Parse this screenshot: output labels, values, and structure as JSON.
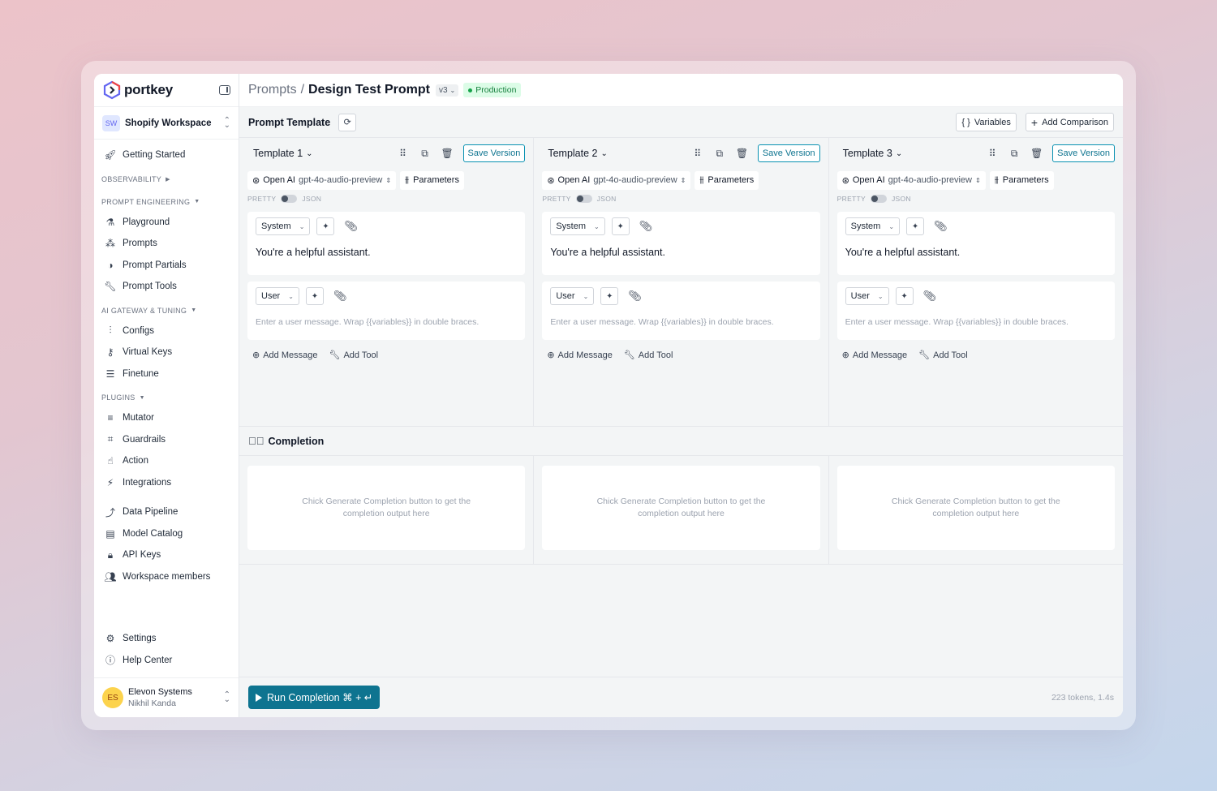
{
  "app": {
    "logo_text": "portkey",
    "accent": "#0e7490",
    "brand_colors": [
      "#6366f1",
      "#ef4444",
      "#1f2937"
    ]
  },
  "workspace": {
    "badge": "SW",
    "name": "Shopify Workspace"
  },
  "sidebar": {
    "getting_started": "Getting Started",
    "sections": {
      "observability": "OBSERVABILITY",
      "prompt_engineering": "PROMPT ENGINEERING",
      "ai_gateway": "AI GATEWAY & TUNING",
      "plugins": "PLUGINS"
    },
    "prompt_items": [
      {
        "label": "Playground",
        "icon": "flask-icon"
      },
      {
        "label": "Prompts",
        "icon": "prompts-icon"
      },
      {
        "label": "Prompt Partials",
        "icon": "partials-icon"
      },
      {
        "label": "Prompt Tools",
        "icon": "wrench-icon"
      }
    ],
    "gateway_items": [
      {
        "label": "Configs",
        "icon": "sliders-icon"
      },
      {
        "label": "Virtual Keys",
        "icon": "key-icon"
      },
      {
        "label": "Finetune",
        "icon": "finetune-icon"
      }
    ],
    "plugin_items": [
      {
        "label": "Mutator",
        "icon": "mutator-icon"
      },
      {
        "label": "Guardrails",
        "icon": "guardrails-icon"
      },
      {
        "label": "Action",
        "icon": "action-icon"
      },
      {
        "label": "Integrations",
        "icon": "plug-icon"
      }
    ],
    "misc_items": [
      {
        "label": "Data Pipeline",
        "icon": "pipeline-icon"
      },
      {
        "label": "Model Catalog",
        "icon": "catalog-icon"
      },
      {
        "label": "API Keys",
        "icon": "lock-icon"
      },
      {
        "label": "Workspace members",
        "icon": "users-icon"
      }
    ],
    "settings": "Settings",
    "help": "Help Center"
  },
  "user": {
    "initials": "ES",
    "org": "Elevon Systems",
    "name": "Nikhil Kanda"
  },
  "header": {
    "breadcrumb_parent": "Prompts",
    "separator": "/",
    "title": "Design Test Prompt",
    "version": "v3",
    "status": "Production"
  },
  "toolbar": {
    "title": "Prompt Template",
    "variables_label": "Variables",
    "add_comparison_label": "Add Comparison"
  },
  "templates": [
    {
      "name": "Template 1",
      "save_label": "Save Version",
      "provider": "Open AI",
      "model": "gpt-4o-audio-preview",
      "params_label": "Parameters",
      "pretty_label": "PRETTY",
      "json_label": "JSON",
      "system_role": "System",
      "system_text": "You're a helpful assistant.",
      "user_role": "User",
      "user_placeholder": "Enter a user message. Wrap {{variables}} in double braces.",
      "add_message": "Add Message",
      "add_tool": "Add Tool",
      "completion_placeholder": "Chick Generate Completion button to get the completion output here"
    },
    {
      "name": "Template 2",
      "save_label": "Save Version",
      "provider": "Open AI",
      "model": "gpt-4o-audio-preview",
      "params_label": "Parameters",
      "pretty_label": "PRETTY",
      "json_label": "JSON",
      "system_role": "System",
      "system_text": "You're a helpful assistant.",
      "user_role": "User",
      "user_placeholder": "Enter a user message. Wrap {{variables}} in double braces.",
      "add_message": "Add Message",
      "add_tool": "Add Tool",
      "completion_placeholder": "Chick Generate Completion button to get the completion output here"
    },
    {
      "name": "Template 3",
      "save_label": "Save Version",
      "provider": "Open AI",
      "model": "gpt-4o-audio-preview",
      "params_label": "Parameters",
      "pretty_label": "PRETTY",
      "json_label": "JSON",
      "system_role": "System",
      "system_text": "You're a helpful assistant.",
      "user_role": "User",
      "user_placeholder": "Enter a user message. Wrap {{variables}} in double braces.",
      "add_message": "Add Message",
      "add_tool": "Add Tool",
      "completion_placeholder": "Chick Generate Completion button to get the completion output here"
    }
  ],
  "completion": {
    "title": "Completion"
  },
  "footer": {
    "run_label": "Run Completion ⌘ + ↵",
    "stats": "223 tokens, 1.4s"
  }
}
